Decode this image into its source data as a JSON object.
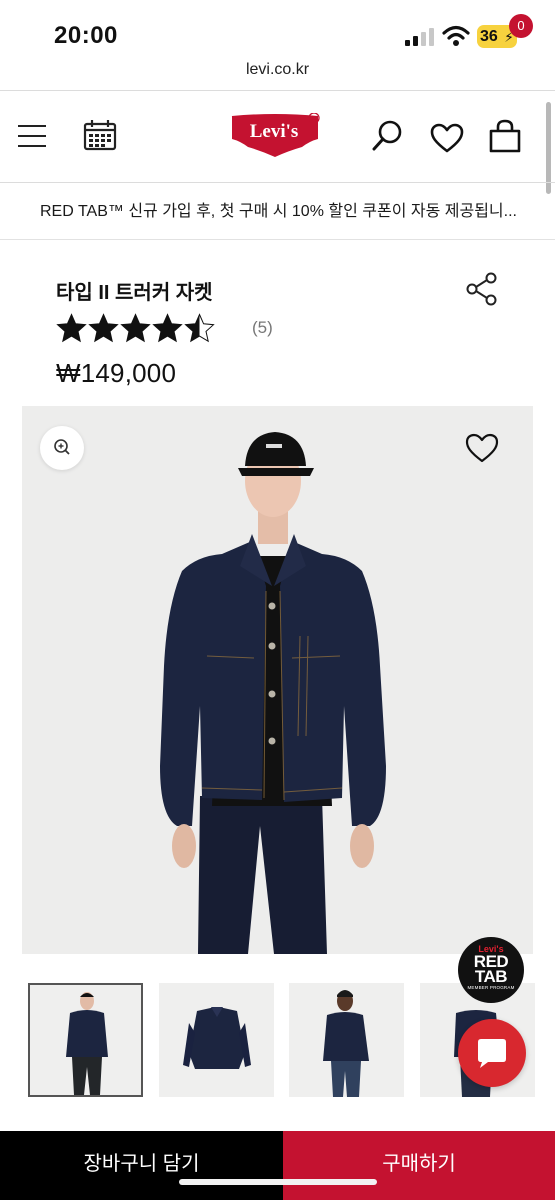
{
  "status_bar": {
    "time": "20:00",
    "battery": "36"
  },
  "browser": {
    "url": "levi.co.kr"
  },
  "header": {
    "logo_text": "Levi's",
    "cart_count": "0"
  },
  "promo": {
    "text": "RED TAB™ 신규 가입 후, 첫 구매 시 10% 할인 쿠폰이 자동 제공됩니..."
  },
  "product": {
    "title": "타입 II 트러커 자켓",
    "rating": 4.5,
    "rating_max": 5,
    "review_count": "(5)",
    "price": "₩149,000"
  },
  "badge": {
    "brand": "Levi's",
    "title_line1": "RED",
    "title_line2": "TAB",
    "subtitle": "MEMBER PROGRAM"
  },
  "thumbnails": [
    {
      "label": "model front view",
      "selected": true
    },
    {
      "label": "jacket flat lay",
      "selected": false
    },
    {
      "label": "model front view 2",
      "selected": false
    },
    {
      "label": "model side view",
      "selected": false
    }
  ],
  "actions": {
    "add_to_cart": "장바구니 담기",
    "buy_now": "구매하기"
  },
  "colors": {
    "brand_red": "#c41230",
    "chat_red": "#d8282f",
    "denim": "#1c2540",
    "star": "#111111"
  },
  "icons": [
    "menu-icon",
    "calendar-icon",
    "search-icon",
    "heart-icon",
    "bag-icon",
    "share-icon",
    "zoom-icon",
    "chat-icon"
  ]
}
